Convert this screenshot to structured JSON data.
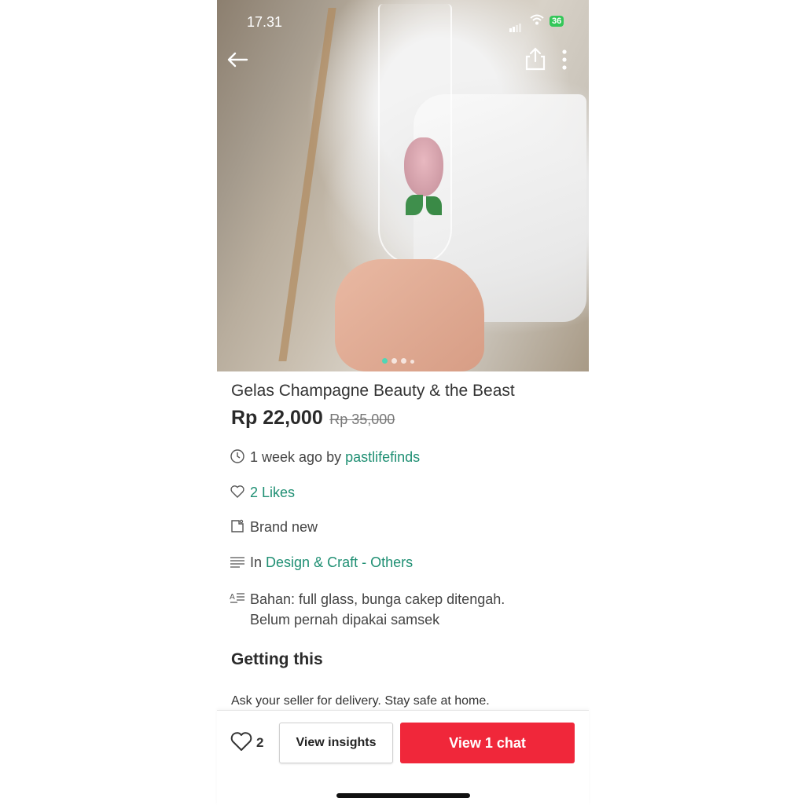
{
  "status_bar": {
    "time": "17.31",
    "battery": "36"
  },
  "listing": {
    "title": "Gelas Champagne Beauty & the Beast",
    "price": "Rp 22,000",
    "original_price": "Rp 35,000",
    "posted": "1 week ago by",
    "seller": "pastlifefinds",
    "likes": "2 Likes",
    "condition": "Brand new",
    "category_prefix": "In",
    "category": "Design & Craft - Others",
    "description_line1": "Bahan: full glass, bunga cakep ditengah.",
    "description_line2": "Belum pernah dipakai samsek",
    "photo_count": 4,
    "current_photo": 1
  },
  "getting_this": {
    "heading": "Getting this",
    "note": "Ask your seller for delivery. Stay safe at home."
  },
  "bottom_bar": {
    "like_count": "2",
    "insights_label": "View insights",
    "chat_label": "View 1 chat"
  },
  "colors": {
    "accent_link": "#1f8f73",
    "chat_button": "#f0273a",
    "dot_active": "#4fd6b5"
  },
  "icons": [
    "back-arrow-icon",
    "share-icon",
    "more-vertical-icon",
    "clock-icon",
    "heart-icon",
    "tag-icon",
    "list-icon",
    "text-description-icon"
  ]
}
